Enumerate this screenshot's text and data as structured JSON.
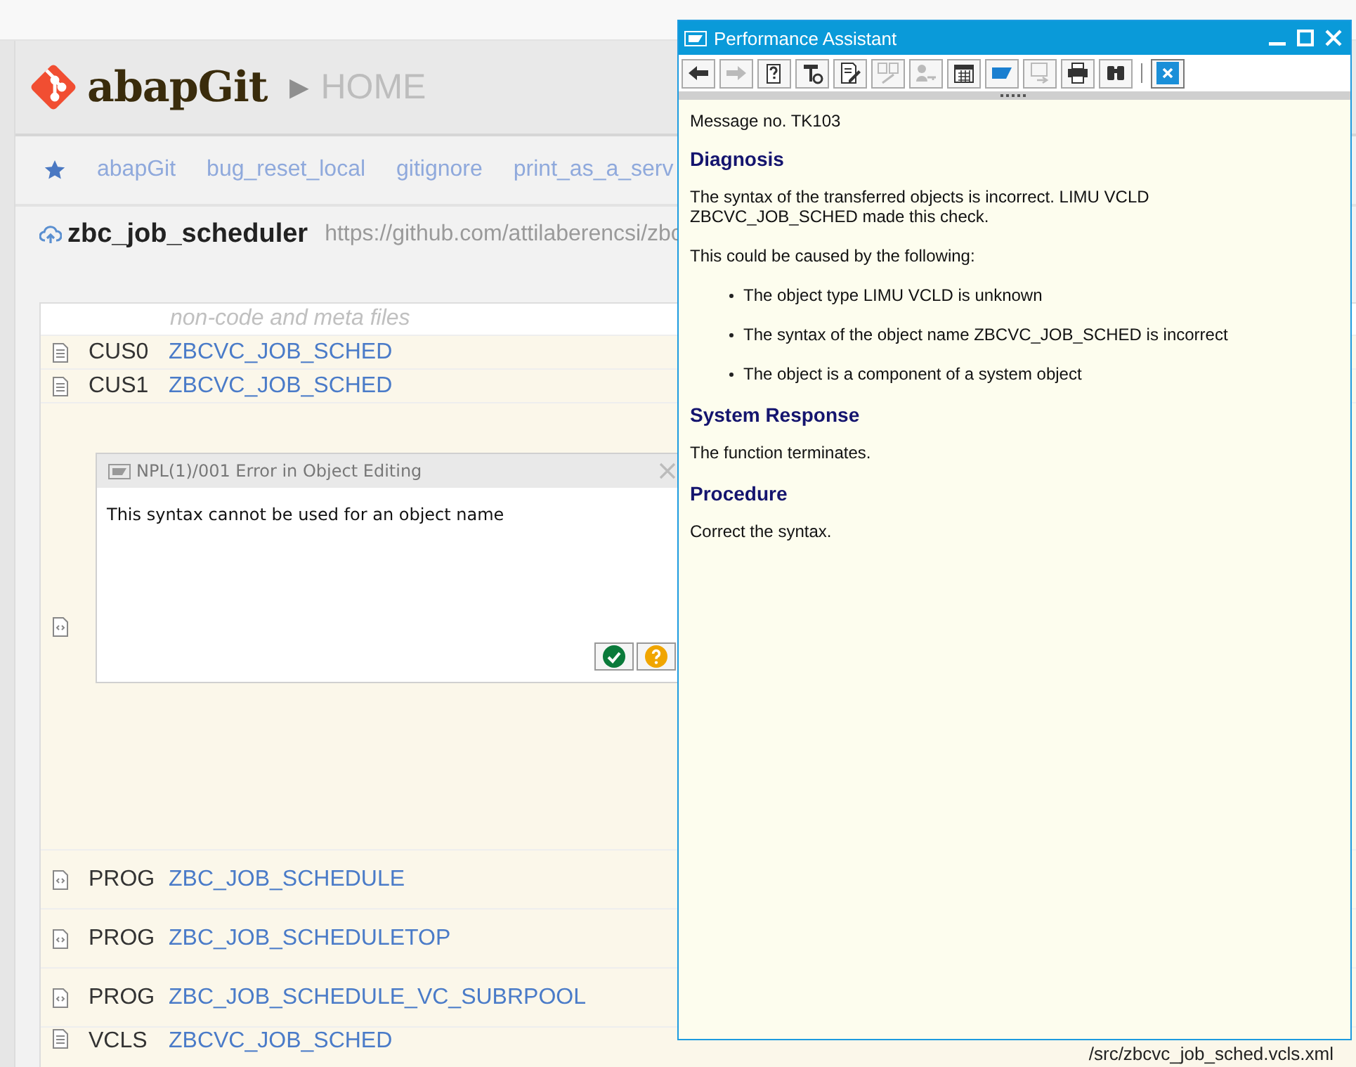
{
  "header": {
    "logo": "abapGit",
    "separator": "▶",
    "page": "HOME"
  },
  "favorites": [
    {
      "label": "abapGit"
    },
    {
      "label": "bug_reset_local"
    },
    {
      "label": "gitignore"
    },
    {
      "label": "print_as_a_serv"
    }
  ],
  "repo": {
    "name": "zbc_job_scheduler",
    "url": "https://github.com/attilaberencsi/zbc"
  },
  "table": {
    "section": "non-code and meta files",
    "rows": [
      {
        "kind": "file",
        "type": "CUS0",
        "name": "ZBCVC_JOB_SCHED"
      },
      {
        "kind": "file",
        "type": "CUS1",
        "name": "ZBCVC_JOB_SCHED"
      },
      {
        "kind": "code"
      },
      {
        "kind": "code",
        "type": "PROG",
        "name": "ZBC_JOB_SCHEDULE"
      },
      {
        "kind": "code",
        "type": "PROG",
        "name": "ZBC_JOB_SCHEDULETOP"
      },
      {
        "kind": "code",
        "type": "PROG",
        "name": "ZBC_JOB_SCHEDULE_VC_SUBRPOOL"
      },
      {
        "kind": "file",
        "type": "VCLS",
        "name": "ZBCVC_JOB_SCHED",
        "path": "/src/zbcvc_job_sched.vcls.xml"
      }
    ]
  },
  "error_dialog": {
    "title": "NPL(1)/001 Error in Object Editing",
    "message": "This syntax cannot be used for an object name",
    "buttons": [
      {
        "kind": "ok"
      },
      {
        "kind": "help"
      }
    ]
  },
  "assistant": {
    "title": "Performance Assistant",
    "toolbar": [
      {
        "kind": "back",
        "disabled": false
      },
      {
        "kind": "forward",
        "disabled": true
      },
      {
        "kind": "help",
        "disabled": false
      },
      {
        "kind": "tools",
        "disabled": false
      },
      {
        "kind": "edit",
        "disabled": false
      },
      {
        "kind": "compare",
        "disabled": true
      },
      {
        "kind": "userkey",
        "disabled": true
      },
      {
        "kind": "calendar",
        "disabled": false
      },
      {
        "kind": "flag",
        "disabled": false
      },
      {
        "kind": "transfer",
        "disabled": true
      },
      {
        "kind": "print",
        "disabled": false
      },
      {
        "kind": "find",
        "disabled": false
      },
      {
        "kind": "separator"
      },
      {
        "kind": "close",
        "disabled": false
      }
    ],
    "message_no": "Message no. TK103",
    "sections": [
      {
        "heading": "Diagnosis",
        "blocks": [
          {
            "kind": "para",
            "lines": [
              "The syntax of the transferred objects is incorrect. LIMU VCLD",
              "ZBCVC_JOB_SCHED made this check."
            ]
          },
          {
            "kind": "para",
            "lines": [
              "This could be caused by the following:"
            ]
          },
          {
            "kind": "bullets",
            "items": [
              "The object type LIMU VCLD is unknown",
              "The syntax of the object name ZBCVC_JOB_SCHED is incorrect",
              "The object is a component of a system object"
            ]
          }
        ]
      },
      {
        "heading": "System Response",
        "blocks": [
          {
            "kind": "para",
            "lines": [
              "The function terminates."
            ]
          }
        ]
      },
      {
        "heading": "Procedure",
        "blocks": [
          {
            "kind": "para",
            "lines": [
              "Correct the syntax."
            ]
          }
        ]
      }
    ]
  }
}
